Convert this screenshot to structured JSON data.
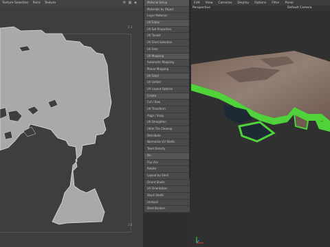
{
  "uv_editor": {
    "menu": [
      "Texture Selection",
      "Paint",
      "Texture"
    ],
    "coords": {
      "top_right": "1.1",
      "bottom_right": "1.0"
    }
  },
  "outliner": {
    "rows": [
      {
        "label": "Material Setup",
        "group": true
      },
      {
        "label": "Materials by Object",
        "group": false
      },
      {
        "label": "Layer Material",
        "group": false
      },
      {
        "label": "UV Editor",
        "group": true
      },
      {
        "label": "UV Set Properties",
        "group": false
      },
      {
        "label": "UV Toolkit",
        "group": false
      },
      {
        "label": "UV Shell Selection",
        "group": false
      },
      {
        "label": "UV Sets",
        "group": false
      },
      {
        "label": "UV Mapping",
        "group": true
      },
      {
        "label": "Automatic Mapping",
        "group": false
      },
      {
        "label": "Planar Mapping",
        "group": false
      },
      {
        "label": "UV Shell",
        "group": true
      },
      {
        "label": "UV Unfold",
        "group": false
      },
      {
        "label": "UV Layout Options",
        "group": false
      },
      {
        "label": "Create",
        "group": true
      },
      {
        "label": "Cut / Sew",
        "group": false
      },
      {
        "label": "UV Transform",
        "group": false
      },
      {
        "label": "Align / Snap",
        "group": false
      },
      {
        "label": "UV Straighten",
        "group": false
      },
      {
        "label": "Udim Tile Cleanup",
        "group": false
      },
      {
        "label": "Distribute",
        "group": false
      },
      {
        "label": "Normalize UV Shells",
        "group": false
      },
      {
        "label": "Texel Density",
        "group": false
      },
      {
        "label": "Pin",
        "group": true
      },
      {
        "label": "Flip UVs",
        "group": false
      },
      {
        "label": "Rotate",
        "group": false
      },
      {
        "label": "Layout by Shell",
        "group": false
      },
      {
        "label": "Orient Shells",
        "group": false
      },
      {
        "label": "UV Orientation",
        "group": false
      },
      {
        "label": "Stack Shells",
        "group": false
      },
      {
        "label": "Unstack",
        "group": false
      },
      {
        "label": "Shell Borders",
        "group": false
      }
    ]
  },
  "viewport": {
    "menu": [
      "Edit",
      "View",
      "Cameras",
      "Display",
      "Options",
      "Filter",
      "Panel"
    ],
    "label_left": "Perspective",
    "label_camera": "Default Camera",
    "colors": {
      "terrain_side": "#4fd23a",
      "terrain_top": "#8a6a5a",
      "water": "#1d2a35"
    }
  }
}
